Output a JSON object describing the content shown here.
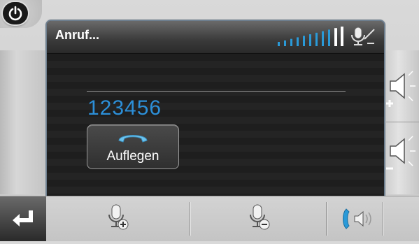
{
  "dialog": {
    "title": "Anruf...",
    "number": "123456",
    "hangup_label": "Auflegen"
  },
  "icons": {
    "power": "power-icon",
    "signal": "signal-strength-icon",
    "mute": "microphone-muted-icon",
    "volume_up": "volume-up-icon",
    "volume_down": "volume-down-icon",
    "back": "return-arrow-icon",
    "mic_plus": "microphone-plus-icon",
    "mic_minus": "microphone-minus-icon",
    "handset_speaker": "handset-speaker-icon",
    "phone": "phone-handset-icon"
  },
  "colors": {
    "number": "#2c8fd8",
    "signal_bars": "#2a9ad8"
  }
}
